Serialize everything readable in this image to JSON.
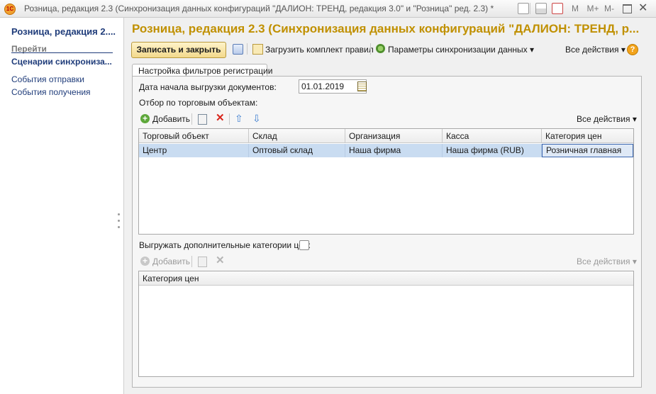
{
  "window": {
    "title": "Розница, редакция 2.3 (Синхронизация данных конфигураций \"ДАЛИОН: ТРЕНД, редакция 3.0\" и \"Розница\" ред. 2.3) *",
    "app_icon_label": "1C",
    "buttons": {
      "m": "M",
      "mplus": "M+",
      "mminus": "M-"
    }
  },
  "sidebar": {
    "title": "Розница, редакция 2....",
    "group": "Перейти",
    "current": "Сценарии синхрониза...",
    "links": [
      "События отправки",
      "События получения"
    ]
  },
  "form": {
    "title": "Розница, редакция 2.3 (Синхронизация данных конфигураций \"ДАЛИОН: ТРЕНД, р...",
    "toolbar": {
      "save_close": "Записать и закрыть",
      "load_rules": "Загрузить комплект правил",
      "sync_params": "Параметры синхронизации данных",
      "all_actions": "Все действия"
    },
    "tab_label": "Настройка фильтров регистрации",
    "date_label": "Дата начала выгрузки документов:",
    "date_value": "01.01.2019",
    "filter_label": "Отбор по торговым объектам:",
    "table1": {
      "add_label": "Добавить",
      "all_actions": "Все действия",
      "columns": [
        "Торговый объект",
        "Склад",
        "Организация",
        "Касса",
        "Категория цен"
      ],
      "rows": [
        [
          "Центр",
          "Оптовый склад",
          "Наша фирма",
          "Наша фирма (RUB)",
          "Розничная главная"
        ]
      ]
    },
    "extra_categories_label": "Выгружать дополнительные категории цен:",
    "extra_categories_checked": false,
    "table2": {
      "add_label": "Добавить",
      "all_actions": "Все действия",
      "columns": [
        "Категория цен"
      ]
    }
  },
  "colors": {
    "title_accent": "#c09000",
    "link": "#1f3c7a",
    "selected_row": "#c9dcf1"
  }
}
